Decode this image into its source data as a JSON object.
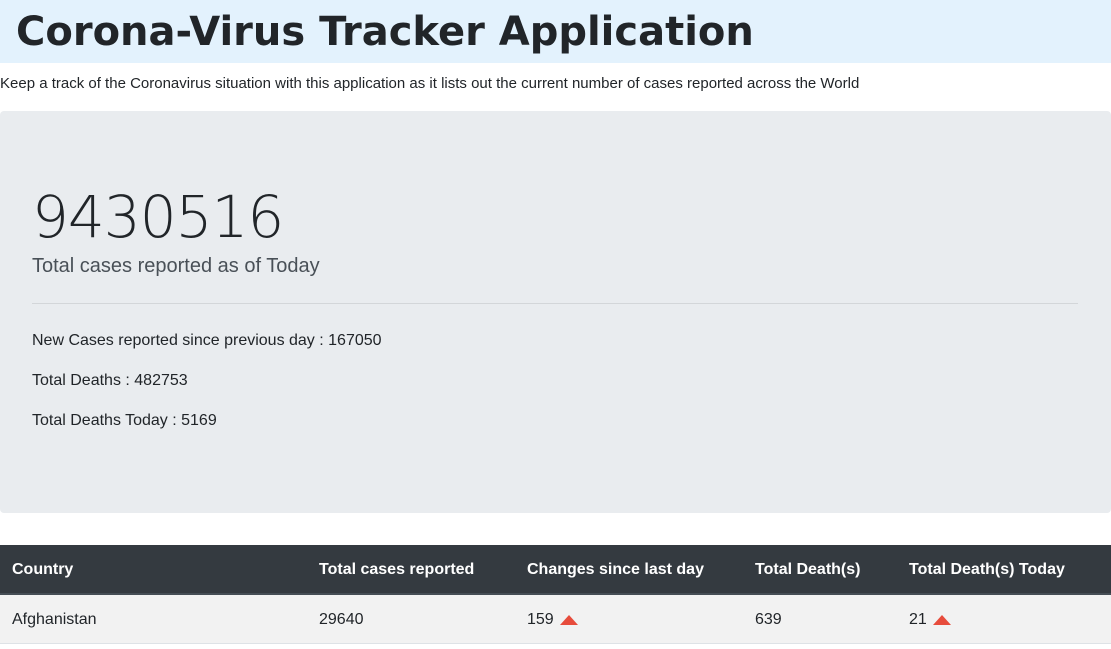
{
  "header": {
    "title": "Corona-Virus Tracker Application"
  },
  "intro": "Keep a track of the Coronavirus situation with this application as it lists out the current number of cases reported across the World",
  "summary": {
    "total_cases": "9430516",
    "total_caption": "Total cases reported as of Today",
    "new_cases": "New Cases reported since previous day : 167050",
    "total_deaths": "Total Deaths : 482753",
    "deaths_today": "Total Deaths Today : 5169"
  },
  "table": {
    "columns": [
      "Country",
      "Total cases reported",
      "Changes since last day",
      "Total Death(s)",
      "Total Death(s) Today"
    ],
    "rows": [
      {
        "country": "Afghanistan",
        "total": "29640",
        "change": "159",
        "deaths": "639",
        "deaths_today": "21"
      }
    ]
  },
  "colors": {
    "header_bg": "#e3f2fd",
    "jumbotron_bg": "#e9ecef",
    "table_head_bg": "#343a40",
    "increase_icon": "#e74c3c"
  }
}
